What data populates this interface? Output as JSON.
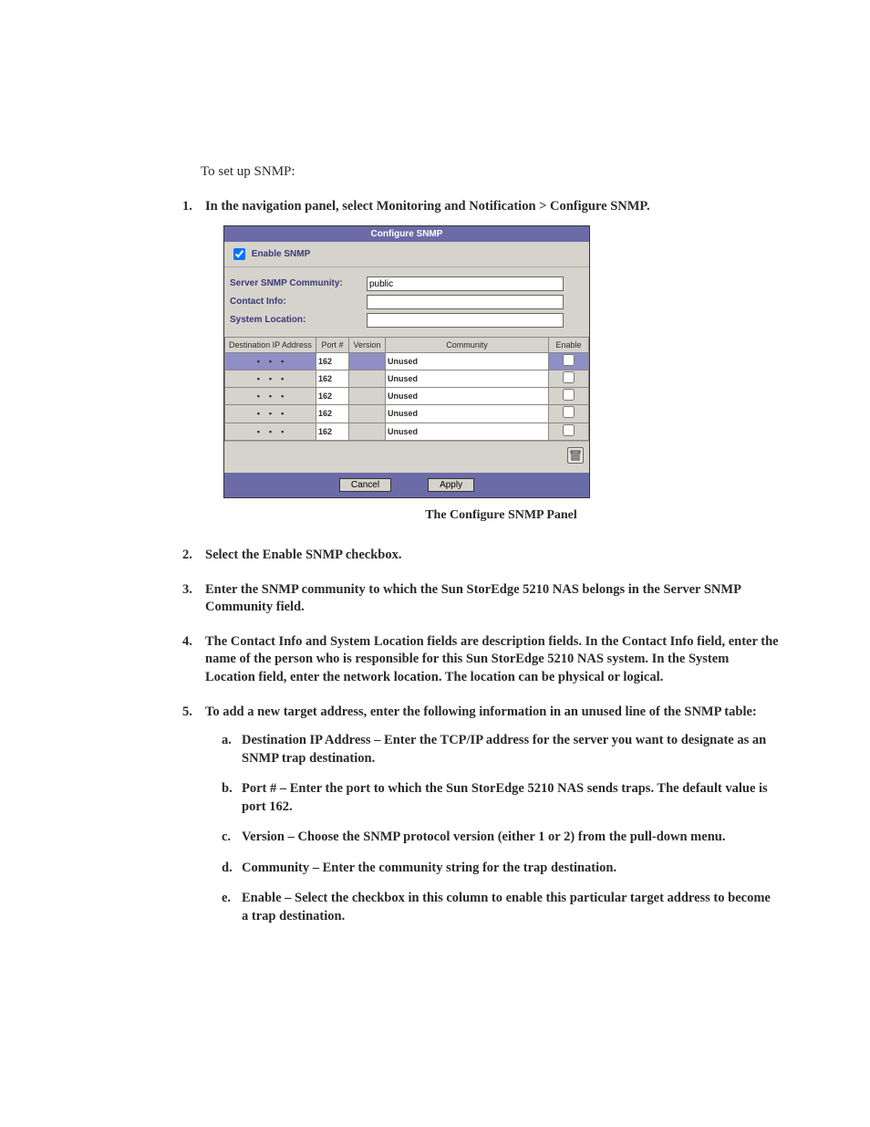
{
  "intro": "To set up SNMP:",
  "steps": [
    {
      "text": "In the navigation panel, select Monitoring and Notification > Configure SNMP."
    },
    {
      "text": "Select the Enable SNMP checkbox."
    },
    {
      "text": "Enter the SNMP community to which the Sun StorEdge 5210 NAS belongs in the Server SNMP Community field."
    },
    {
      "text": "The Contact Info and System Location fields are description fields. In the Contact Info field, enter the name of the person who is responsible for this Sun StorEdge 5210 NAS system. In the System Location field, enter the network location. The location can be physical or logical."
    },
    {
      "text": "To add a new target address, enter the following information in an unused line of the SNMP table:"
    }
  ],
  "substeps": [
    {
      "marker": "a.",
      "text": "Destination IP Address – Enter the TCP/IP address for the server you want to designate as an SNMP trap destination."
    },
    {
      "marker": "b.",
      "text": "Port # – Enter the port to which the Sun StorEdge 5210 NAS sends traps. The default value is port 162."
    },
    {
      "marker": "c.",
      "text": "Version – Choose the SNMP protocol version (either 1 or 2) from the pull-down menu."
    },
    {
      "marker": "d.",
      "text": "Community – Enter the community string for the trap destination."
    },
    {
      "marker": "e.",
      "text": "Enable – Select the checkbox in this column to enable this particular target address to become a trap destination."
    }
  ],
  "panel": {
    "title": "Configure SNMP",
    "enable_label": "Enable SNMP",
    "enable_checked": true,
    "fields": {
      "community_label": "Server SNMP Community:",
      "community_value": "public",
      "contact_label": "Contact Info:",
      "contact_value": "",
      "location_label": "System Location:",
      "location_value": ""
    },
    "headers": {
      "ip": "Destination IP Address",
      "port": "Port #",
      "version": "Version",
      "community": "Community",
      "enable": "Enable"
    },
    "rows": [
      {
        "ip": [
          "",
          "",
          "",
          ""
        ],
        "port": "162",
        "version": "",
        "community": "Unused",
        "enable": false,
        "selected": true
      },
      {
        "ip": [
          "",
          "",
          "",
          ""
        ],
        "port": "162",
        "version": "",
        "community": "Unused",
        "enable": false,
        "selected": false
      },
      {
        "ip": [
          "",
          "",
          "",
          ""
        ],
        "port": "162",
        "version": "",
        "community": "Unused",
        "enable": false,
        "selected": false
      },
      {
        "ip": [
          "",
          "",
          "",
          ""
        ],
        "port": "162",
        "version": "",
        "community": "Unused",
        "enable": false,
        "selected": false
      },
      {
        "ip": [
          "",
          "",
          "",
          ""
        ],
        "port": "162",
        "version": "",
        "community": "Unused",
        "enable": false,
        "selected": false
      }
    ],
    "buttons": {
      "cancel": "Cancel",
      "apply": "Apply"
    }
  },
  "caption": "The Configure SNMP Panel"
}
